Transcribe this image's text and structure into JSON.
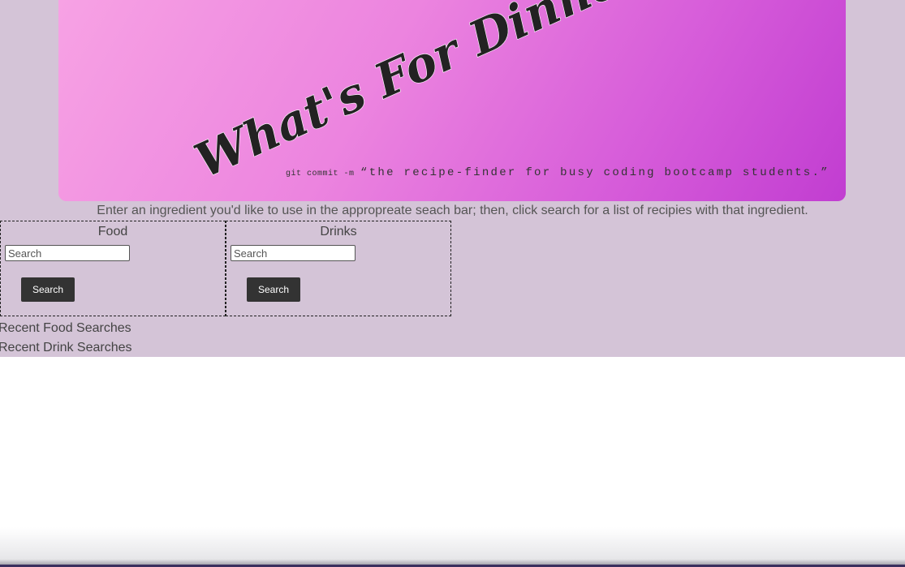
{
  "header": {
    "title": "What's For Dinner?",
    "commit_prefix": "git commit -m",
    "tagline": "“the recipe-finder for busy coding bootcamp students.”"
  },
  "instructions": "Enter an ingredient you'd like to use in the appropreate seach bar; then, click search for a list of recipies with that ingredient.",
  "food": {
    "title": "Food",
    "placeholder": "Search",
    "button_label": "Search"
  },
  "drinks": {
    "title": "Drinks",
    "placeholder": "Search",
    "button_label": "Search"
  },
  "recent": {
    "food_label": "Recent Food Searches",
    "drink_label": "Recent Drink Searches"
  },
  "colors": {
    "page_background": "#d4c4d7",
    "banner_start": "#f7a2e4",
    "banner_end": "#c13dd1",
    "button": "#333333"
  }
}
